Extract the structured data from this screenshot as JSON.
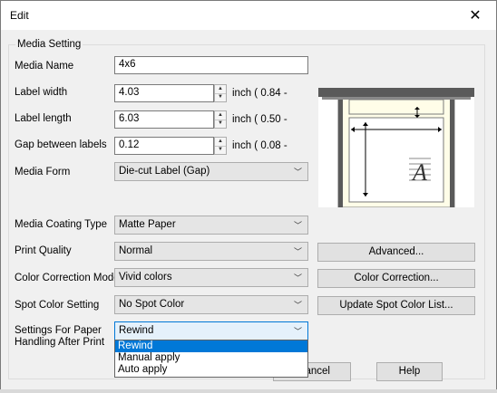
{
  "dialog": {
    "title": "Edit",
    "close_glyph": "✕"
  },
  "group": {
    "label": "Media Setting"
  },
  "fields": {
    "media_name": {
      "label": "Media Name",
      "value": "4x6"
    },
    "label_width": {
      "label": "Label width",
      "value": "4.03",
      "range": "inch ( 0.84 -"
    },
    "label_length": {
      "label": "Label length",
      "value": "6.03",
      "range": "inch ( 0.50 -"
    },
    "gap": {
      "label": "Gap between labels",
      "value": "0.12",
      "range": "inch ( 0.08 -"
    },
    "media_form": {
      "label": "Media Form",
      "value": "Die-cut Label (Gap)"
    },
    "media_coating": {
      "label": "Media Coating Type",
      "value": "Matte Paper"
    },
    "print_quality": {
      "label": "Print Quality",
      "value": "Normal"
    },
    "color_correction": {
      "label": "Color Correction Mode",
      "value": "Vivid colors"
    },
    "spot_color": {
      "label": "Spot Color Setting",
      "value": "No Spot Color"
    },
    "paper_handling": {
      "label_line1": "Settings For Paper",
      "label_line2": "Handling After Print",
      "value": "Rewind",
      "options": [
        "Rewind",
        "Manual apply",
        "Auto apply"
      ]
    }
  },
  "buttons": {
    "advanced": "Advanced...",
    "color_correction": "Color Correction...",
    "update_spot": "Update Spot Color List...",
    "cancel_partial": "ancel",
    "help": "Help"
  },
  "preview": {
    "letter": "A"
  },
  "colors": {
    "accent": "#0078d7",
    "label_paper": "#fffde8",
    "dark_frame": "#5a5a5a"
  }
}
